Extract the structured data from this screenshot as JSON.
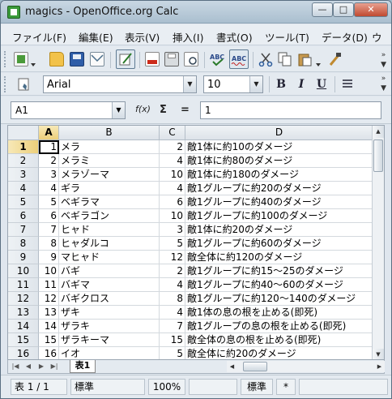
{
  "window": {
    "title": "magics - OpenOffice.org Calc"
  },
  "window_controls": {
    "minimize": "—",
    "maximize": "□",
    "close": "✕"
  },
  "menu": {
    "items": [
      "ファイル(F)",
      "編集(E)",
      "表示(V)",
      "挿入(I)",
      "書式(O)",
      "ツール(T)",
      "データ(D)",
      "ウ"
    ]
  },
  "toolbar_overflow": "»",
  "formatting": {
    "font_name": "Arial",
    "font_size": "10",
    "bold": "B",
    "italic": "I",
    "underline": "U"
  },
  "formula_bar": {
    "cell_ref": "A1",
    "function_wizard_label": "f(x)",
    "sum_label": "Σ",
    "equals_label": "=",
    "content": "1"
  },
  "sheet": {
    "columns": [
      "A",
      "B",
      "C",
      "D"
    ],
    "selected_column": "A",
    "selected_row": "1",
    "rows": [
      {
        "num": "1",
        "a": "1",
        "b": "メラ",
        "c": "2",
        "d": "敵1体に約10のダメージ"
      },
      {
        "num": "2",
        "a": "2",
        "b": "メラミ",
        "c": "4",
        "d": "敵1体に約80のダメージ"
      },
      {
        "num": "3",
        "a": "3",
        "b": "メラゾーマ",
        "c": "10",
        "d": "敵1体に約180のダメージ"
      },
      {
        "num": "4",
        "a": "4",
        "b": "ギラ",
        "c": "4",
        "d": "敵1グループに約20のダメージ"
      },
      {
        "num": "5",
        "a": "5",
        "b": "ベギラマ",
        "c": "6",
        "d": "敵1グループに約40のダメージ"
      },
      {
        "num": "6",
        "a": "6",
        "b": "ベギラゴン",
        "c": "10",
        "d": "敵1グループに約100のダメージ"
      },
      {
        "num": "7",
        "a": "7",
        "b": "ヒャド",
        "c": "3",
        "d": "敵1体に約20のダメージ"
      },
      {
        "num": "8",
        "a": "8",
        "b": "ヒャダルコ",
        "c": "5",
        "d": "敵1グループに約60のダメージ"
      },
      {
        "num": "9",
        "a": "9",
        "b": "マヒャド",
        "c": "12",
        "d": "敵全体に約120のダメージ"
      },
      {
        "num": "10",
        "a": "10",
        "b": "バギ",
        "c": "2",
        "d": "敵1グループに約15〜25のダメージ"
      },
      {
        "num": "11",
        "a": "11",
        "b": "バギマ",
        "c": "4",
        "d": "敵1グループに約40〜60のダメージ"
      },
      {
        "num": "12",
        "a": "12",
        "b": "バギクロス",
        "c": "8",
        "d": "敵1グループに約120〜140のダメージ"
      },
      {
        "num": "13",
        "a": "13",
        "b": "ザキ",
        "c": "4",
        "d": "敵1体の息の根を止める(即死)"
      },
      {
        "num": "14",
        "a": "14",
        "b": "ザラキ",
        "c": "7",
        "d": "敵1グループの息の根を止める(即死)"
      },
      {
        "num": "15",
        "a": "15",
        "b": "ザラキーマ",
        "c": "15",
        "d": "敵全体の息の根を止める(即死)"
      },
      {
        "num": "16",
        "a": "16",
        "b": "イオ",
        "c": "5",
        "d": "敵全体に約20のダメージ"
      }
    ]
  },
  "sheet_tab": {
    "label": "表1"
  },
  "scroll_arrows": {
    "up": "▲",
    "down": "▼",
    "left": "◀",
    "right": "▶"
  },
  "tab_nav": [
    "|◀",
    "◀",
    "▶",
    "▶|"
  ],
  "status": {
    "sheet": "表 1 / 1",
    "page_style": "標準",
    "zoom": "100%",
    "mode": "標準",
    "modified": "*"
  },
  "icons": [
    "new-document-icon",
    "open-folder-icon",
    "save-icon",
    "email-icon",
    "edit-file-icon",
    "export-pdf-icon",
    "print-icon",
    "page-preview-icon",
    "spellcheck-icon",
    "autospellcheck-icon",
    "cut-icon",
    "copy-icon",
    "paste-icon",
    "clone-formatting-icon",
    "styles-icon",
    "align-icon"
  ]
}
